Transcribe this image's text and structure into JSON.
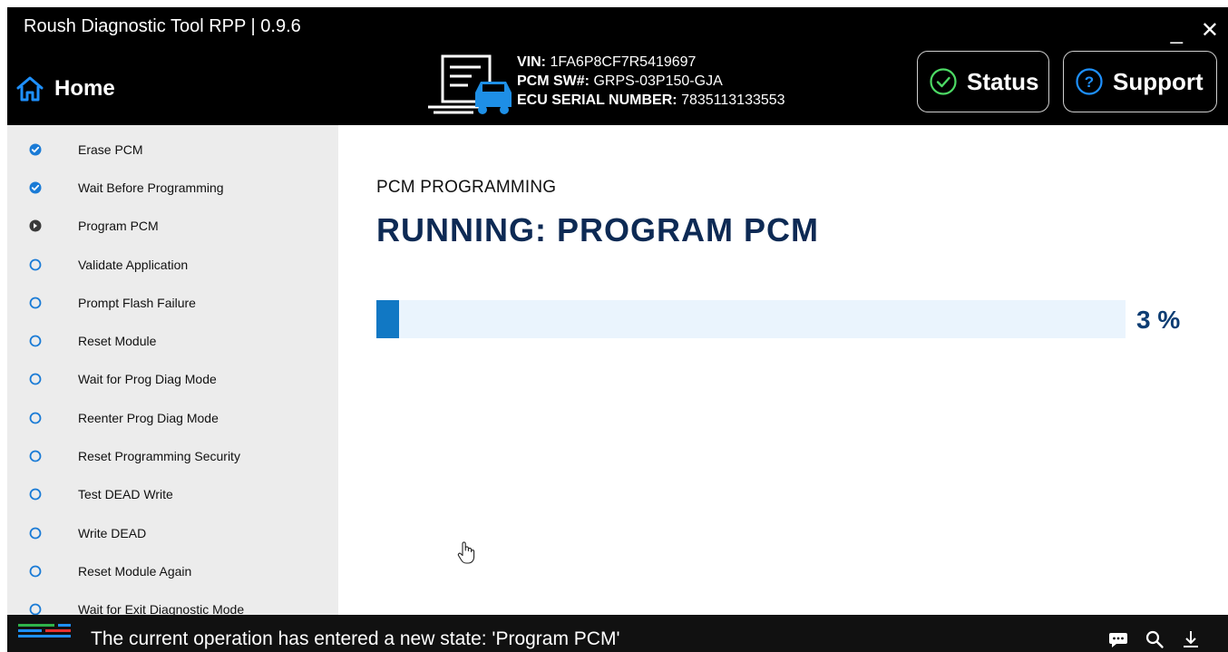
{
  "app": {
    "title": "Roush Diagnostic Tool RPP | 0.9.6",
    "minimize_glyph": "_",
    "close_glyph": "✕",
    "home_label": "Home"
  },
  "vehicle": {
    "vin_label": "VIN:",
    "vin_value": "1FA6P8CF7R5419697",
    "pcm_sw_label": "PCM SW#:",
    "pcm_sw_value": "GRPS-03P150-GJA",
    "ecu_label": "ECU SERIAL NUMBER:",
    "ecu_value": "7835113133553"
  },
  "header_buttons": {
    "status_label": "Status",
    "support_label": "Support"
  },
  "steps": [
    {
      "label": "Erase PCM",
      "state": "done"
    },
    {
      "label": "Wait Before Programming",
      "state": "done"
    },
    {
      "label": "Program PCM",
      "state": "current"
    },
    {
      "label": "Validate Application",
      "state": "pending"
    },
    {
      "label": "Prompt Flash Failure",
      "state": "pending"
    },
    {
      "label": "Reset Module",
      "state": "pending"
    },
    {
      "label": "Wait for Prog Diag Mode",
      "state": "pending"
    },
    {
      "label": "Reenter Prog Diag Mode",
      "state": "pending"
    },
    {
      "label": "Reset Programming Security",
      "state": "pending"
    },
    {
      "label": "Test DEAD Write",
      "state": "pending"
    },
    {
      "label": "Write DEAD",
      "state": "pending"
    },
    {
      "label": "Reset Module Again",
      "state": "pending"
    },
    {
      "label": "Wait for Exit Diagnostic Mode",
      "state": "pending"
    }
  ],
  "main": {
    "section_label": "PCM PROGRAMMING",
    "running_title": "RUNNING: PROGRAM PCM",
    "progress_percent": 3,
    "progress_text": "3 %"
  },
  "statusbar": {
    "message": "The current operation has entered a new state: 'Program PCM'"
  },
  "colors": {
    "accent": "#1178c4",
    "title_navy": "#0d2a54",
    "step_done": "#1a7bd6",
    "step_current": "#3a3a3a",
    "step_pending": "#1a7bd6"
  },
  "icons": [
    "home-icon",
    "vehicle-document-icon",
    "check-circle-icon",
    "question-circle-icon",
    "step-check-icon",
    "step-arrow-icon",
    "step-pending-icon",
    "chat-icon",
    "search-icon",
    "download-icon",
    "roush-logo-icon",
    "hand-cursor-icon"
  ]
}
